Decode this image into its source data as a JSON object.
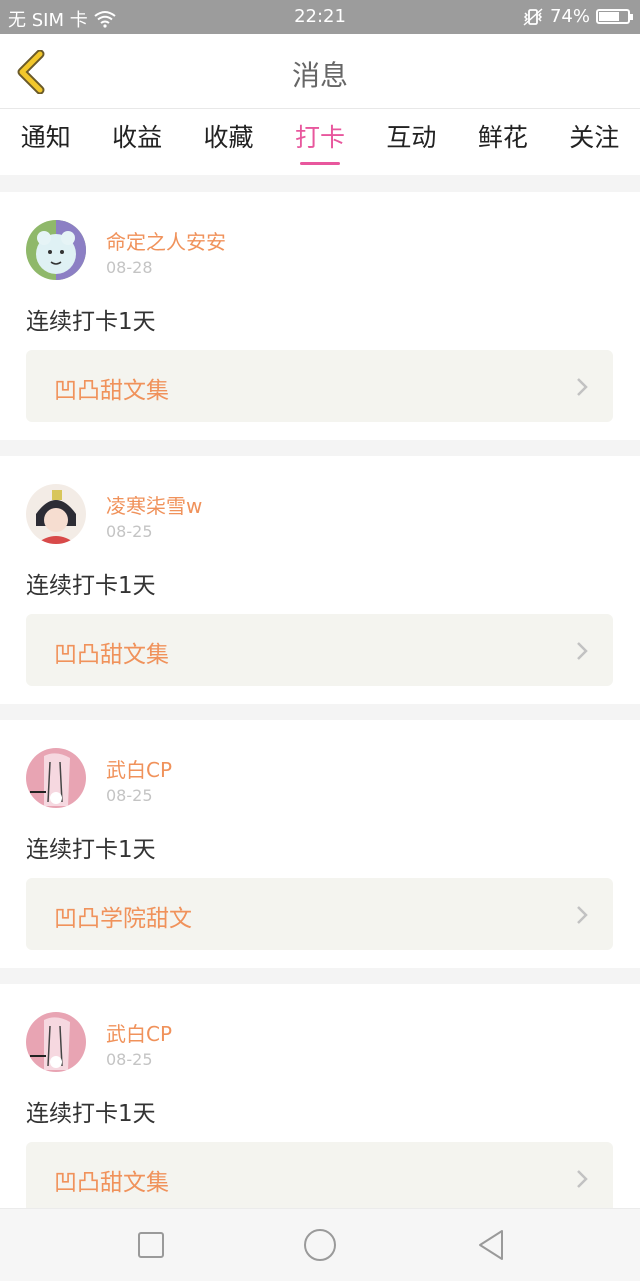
{
  "status_bar": {
    "carrier": "无 SIM 卡",
    "time": "22:21",
    "battery": "74%",
    "battery_level": 0.74,
    "wifi_icon": "wifi-icon",
    "vibrate_icon": "vibrate-icon"
  },
  "header": {
    "title": "消息",
    "back_icon": "back-chevron-icon",
    "back_color": "#f2c72b"
  },
  "tabs": [
    {
      "label": "通知",
      "active": false
    },
    {
      "label": "收益",
      "active": false
    },
    {
      "label": "收藏",
      "active": false
    },
    {
      "label": "打卡",
      "active": true
    },
    {
      "label": "互动",
      "active": false
    },
    {
      "label": "鲜花",
      "active": false
    },
    {
      "label": "关注",
      "active": false
    }
  ],
  "accent_color": "#e8579d",
  "name_color": "#f0925b",
  "cards": [
    {
      "user": "命定之人安安",
      "date": "08-28",
      "text": "连续打卡1天",
      "topic": "凹凸甜文集"
    },
    {
      "user": "凌寒柒雪w",
      "date": "08-25",
      "text": "连续打卡1天",
      "topic": "凹凸甜文集"
    },
    {
      "user": "武白CP",
      "date": "08-25",
      "text": "连续打卡1天",
      "topic": "凹凸学院甜文"
    },
    {
      "user": "武白CP",
      "date": "08-25",
      "text": "连续打卡1天",
      "topic": "凹凸甜文集"
    }
  ],
  "nav": {
    "recent_icon": "square-recent-icon",
    "home_icon": "circle-home-icon",
    "back_icon": "triangle-back-icon"
  }
}
